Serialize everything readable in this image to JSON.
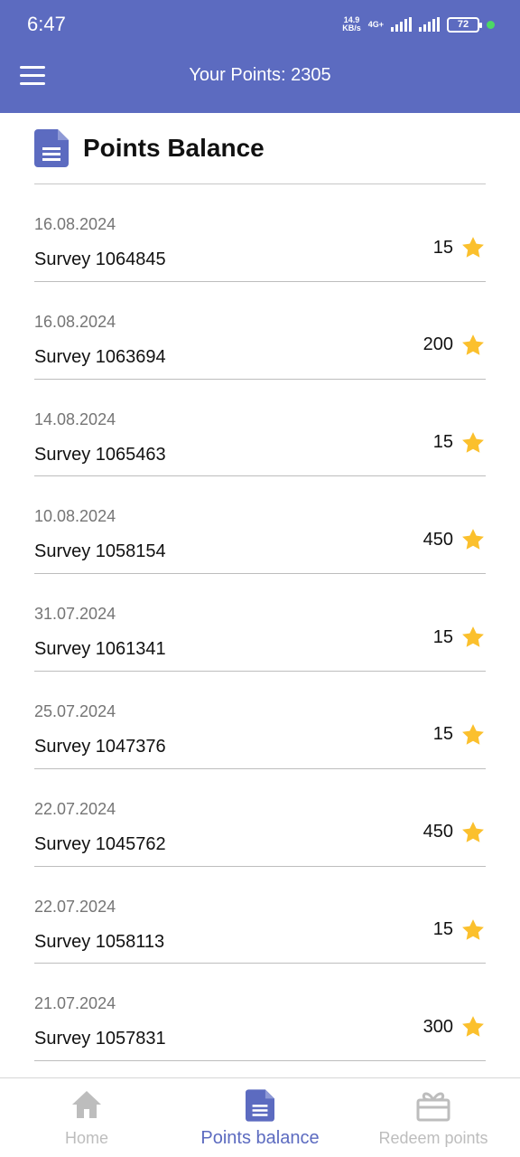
{
  "status": {
    "time": "6:47",
    "net_speed_value": "14.9",
    "net_speed_unit": "KB/s",
    "network": "4G+",
    "battery": "72"
  },
  "appbar": {
    "title": "Your Points: 2305"
  },
  "header": {
    "title": "Points Balance",
    "icon": "document-icon"
  },
  "entries": [
    {
      "date": "16.08.2024",
      "name": "Survey 1064845",
      "points": "15"
    },
    {
      "date": "16.08.2024",
      "name": "Survey 1063694",
      "points": "200"
    },
    {
      "date": "14.08.2024",
      "name": "Survey 1065463",
      "points": "15"
    },
    {
      "date": "10.08.2024",
      "name": "Survey 1058154",
      "points": "450"
    },
    {
      "date": "31.07.2024",
      "name": "Survey 1061341",
      "points": "15"
    },
    {
      "date": "25.07.2024",
      "name": "Survey 1047376",
      "points": "15"
    },
    {
      "date": "22.07.2024",
      "name": "Survey 1045762",
      "points": "450"
    },
    {
      "date": "22.07.2024",
      "name": "Survey 1058113",
      "points": "15"
    },
    {
      "date": "21.07.2024",
      "name": "Survey 1057831",
      "points": "300"
    }
  ],
  "nav": {
    "home": "Home",
    "points_balance": "Points balance",
    "redeem": "Redeem points"
  },
  "colors": {
    "primary": "#5c6bc0",
    "star": "#fbc02d",
    "inactive": "#bdbdbd"
  }
}
